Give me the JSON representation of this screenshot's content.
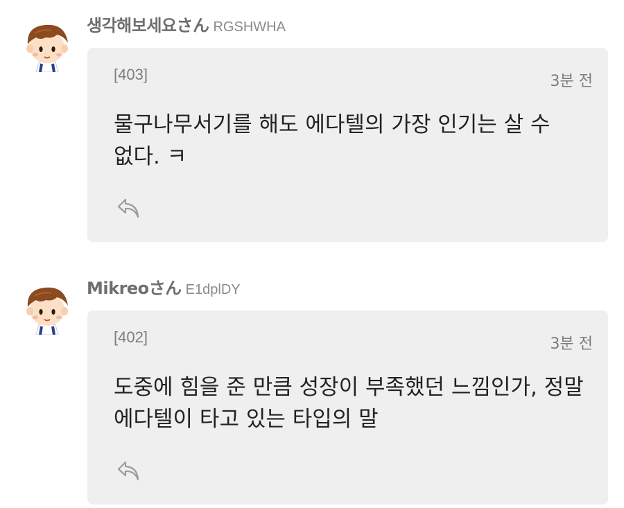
{
  "comments": [
    {
      "author": "생각해보세요さん",
      "user_id": "RGSHWHA",
      "number": "[403]",
      "time": "3분 전",
      "text": "물구나무서기를 해도 에다텔의 가장 인기는 살 수 없다. ㅋ",
      "avatar_icon": "boy-avatar-icon",
      "reply_icon": "reply-arrow-icon"
    },
    {
      "author": "Mikreoさん",
      "user_id": "E1dplDY",
      "number": "[402]",
      "time": "3분 전",
      "text": "도중에 힘을 준 만큼 성장이 부족했던 느낌인가, 정말 에다텔이 타고 있는 타입의 말",
      "avatar_icon": "boy-avatar-icon",
      "reply_icon": "reply-arrow-icon"
    }
  ]
}
